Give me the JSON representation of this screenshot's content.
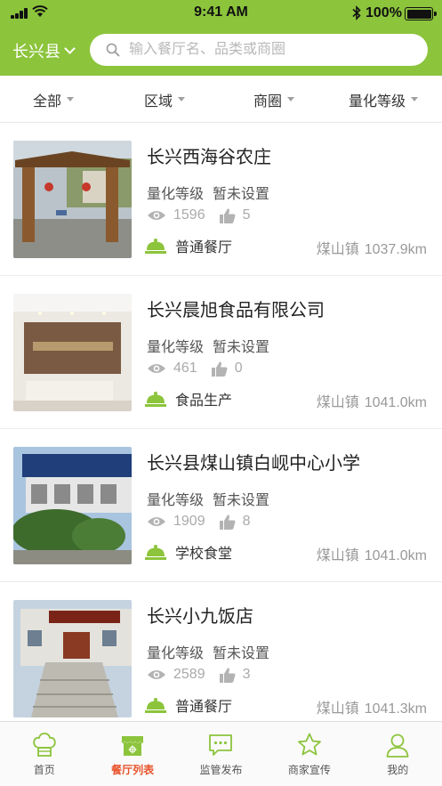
{
  "status_bar": {
    "time": "9:41 AM",
    "battery": "100%"
  },
  "header": {
    "city": "长兴县",
    "search_placeholder": "输入餐厅名、品类或商圈"
  },
  "filters": [
    "全部",
    "区域",
    "商圈",
    "量化等级"
  ],
  "grade_label": "量化等级",
  "restaurants": [
    {
      "name": "长兴西海谷农庄",
      "grade": "暂未设置",
      "views": "1596",
      "likes": "5",
      "type": "普通餐厅",
      "town": "煤山镇",
      "distance": "1037.9km"
    },
    {
      "name": "长兴晨旭食品有限公司",
      "grade": "暂未设置",
      "views": "461",
      "likes": "0",
      "type": "食品生产",
      "town": "煤山镇",
      "distance": "1041.0km"
    },
    {
      "name": "长兴县煤山镇白岘中心小学",
      "grade": "暂未设置",
      "views": "1909",
      "likes": "8",
      "type": "学校食堂",
      "town": "煤山镇",
      "distance": "1041.0km"
    },
    {
      "name": "长兴小九饭店",
      "grade": "暂未设置",
      "views": "2589",
      "likes": "3",
      "type": "普通餐厅",
      "town": "煤山镇",
      "distance": "1041.3km"
    }
  ],
  "tabs": [
    {
      "label": "首页",
      "icon": "chef-hat-icon"
    },
    {
      "label": "餐厅列表",
      "icon": "storefront-icon"
    },
    {
      "label": "监管发布",
      "icon": "chat-bubble-icon"
    },
    {
      "label": "商家宣传",
      "icon": "star-icon"
    },
    {
      "label": "我的",
      "icon": "user-icon"
    }
  ],
  "active_tab": 1,
  "colors": {
    "brand_green": "#8cc43c",
    "active_tab": "#e8542b",
    "icon_green": "#8cc43c"
  }
}
